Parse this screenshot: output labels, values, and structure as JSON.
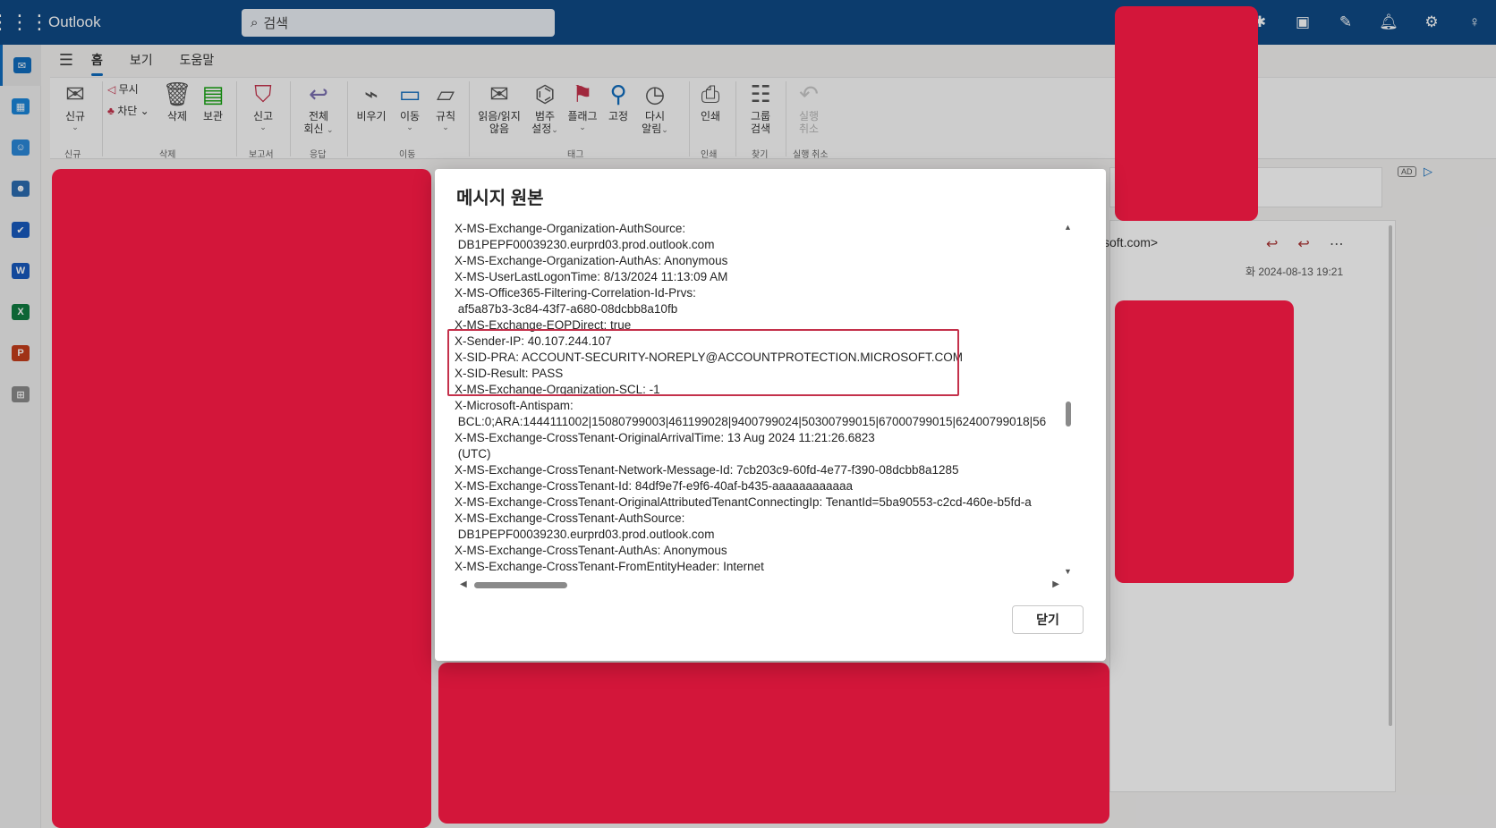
{
  "app": {
    "title": "Outlook"
  },
  "search": {
    "placeholder": "검색"
  },
  "tabs": [
    {
      "label": "홈",
      "selected": true
    },
    {
      "label": "보기",
      "selected": false
    },
    {
      "label": "도움말",
      "selected": false
    }
  ],
  "ribbon": {
    "new": "신규",
    "ignore": "무시",
    "block": "차단",
    "delete": "삭제",
    "archive": "보관",
    "report": "신고",
    "reply_all_1": "전체",
    "reply_all_2": "회신",
    "sweep": "비우기",
    "move": "이동",
    "rules": "규칙",
    "read_1": "읽음/읽지",
    "read_2": "않음",
    "categorize_1": "범주",
    "categorize_2": "설정",
    "flag": "플래그",
    "pin": "고정",
    "snooze_1": "다시",
    "snooze_2": "알림",
    "print": "인쇄",
    "group_1": "그룹",
    "group_2": "검색",
    "undo_1": "실행",
    "undo_2": "취소",
    "groups": {
      "new": "신규",
      "delete": "삭제",
      "report": "보고서",
      "respond": "응답",
      "move": "이동",
      "tags": "태그",
      "print": "인쇄",
      "find": "찾기",
      "undo": "실행 취소"
    }
  },
  "reading_pane": {
    "from_fragment": "soft.com>",
    "date": "화 2024-08-13 19:21",
    "ad_badge": "AD"
  },
  "dialog": {
    "title": "메시지 원본",
    "close_label": "닫기",
    "header_lines": [
      "X-MS-Exchange-Organization-AuthSource:",
      " DB1PEPF00039230.eurprd03.prod.outlook.com",
      "X-MS-Exchange-Organization-AuthAs: Anonymous",
      "X-MS-UserLastLogonTime: 8/13/2024 11:13:09 AM",
      "X-MS-Office365-Filtering-Correlation-Id-Prvs:",
      " af5a87b3-3c84-43f7-a680-08dcbb8a10fb",
      "X-MS-Exchange-EOPDirect: true",
      "X-Sender-IP: 40.107.244.107",
      "X-SID-PRA: ACCOUNT-SECURITY-NOREPLY@ACCOUNTPROTECTION.MICROSOFT.COM",
      "X-SID-Result: PASS",
      "X-MS-Exchange-Organization-SCL: -1",
      "X-Microsoft-Antispam:",
      " BCL:0;ARA:1444111002|15080799003|461199028|9400799024|50300799015|67000799015|62400799018|56",
      "X-MS-Exchange-CrossTenant-OriginalArrivalTime: 13 Aug 2024 11:21:26.6823",
      " (UTC)",
      "X-MS-Exchange-CrossTenant-Network-Message-Id: 7cb203c9-60fd-4e77-f390-08dcbb8a1285",
      "X-MS-Exchange-CrossTenant-Id: 84df9e7f-e9f6-40af-b435-aaaaaaaaaaaa",
      "X-MS-Exchange-CrossTenant-OriginalAttributedTenantConnectingIp: TenantId=5ba90553-c2cd-460e-b5fd-a",
      "X-MS-Exchange-CrossTenant-AuthSource:",
      " DB1PEPF00039230.eurprd03.prod.outlook.com",
      "X-MS-Exchange-CrossTenant-AuthAs: Anonymous",
      "X-MS-Exchange-CrossTenant-FromEntityHeader: Internet"
    ]
  },
  "colors": {
    "topbar": "#0f4a85",
    "accent": "#0f6cbd",
    "highlight_box": "#c4314b",
    "redaction": "#d3163a"
  },
  "icons": {
    "waffle": "app-launcher-icon",
    "search": "search-icon",
    "teams": "teams-icon",
    "onenote": "onenote-icon",
    "feedback": "feedback-icon",
    "bell": "bell-icon",
    "settings": "gear-icon",
    "tips": "lightbulb-icon"
  }
}
